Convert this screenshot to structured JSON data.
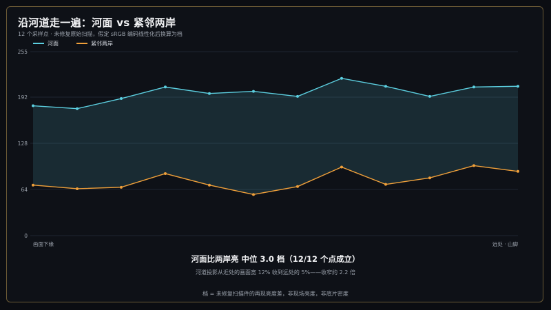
{
  "title": "沿河道走一遍：河面 vs 紧邻两岸",
  "subtitle": "12 个采样点 · 未修复原始扫描，假定 sRGB 编码线性化后换算为档",
  "summary": "河面比两岸亮 中位 3.0 档（12/12 个点成立）",
  "detail": "河道投影从近处的画面宽 12% 收到远处的 5%——收窄约 2.2 倍",
  "footnote": "档 = 未修复扫描件的再现亮度差，非现场亮度，非底片密度",
  "colors": {
    "river": "#5ccfe0",
    "banks": "#f0a03a",
    "background": "#0e1117",
    "border": "#6b5a35",
    "grid": "#1f2530"
  },
  "chart_data": {
    "type": "line",
    "x": [
      1,
      2,
      3,
      4,
      5,
      6,
      7,
      8,
      9,
      10,
      11,
      12
    ],
    "x_tick_labels": [
      {
        "x": 1,
        "label": "画面下缘"
      },
      {
        "x": 12,
        "label": "远处 · 山脚"
      }
    ],
    "ylim": [
      0,
      255
    ],
    "yticks": [
      0,
      64,
      128,
      192,
      255
    ],
    "grid": true,
    "legend_position": "top-left",
    "fill_between_series": true,
    "series": [
      {
        "name": "河面",
        "color": "#5ccfe0",
        "values": [
          180,
          176,
          190,
          206,
          197,
          200,
          193,
          218,
          207,
          193,
          206,
          207
        ]
      },
      {
        "name": "紧邻两岸",
        "color": "#f0a03a",
        "values": [
          70,
          65,
          67,
          86,
          70,
          57,
          68,
          95,
          71,
          80,
          97,
          89
        ]
      }
    ]
  }
}
